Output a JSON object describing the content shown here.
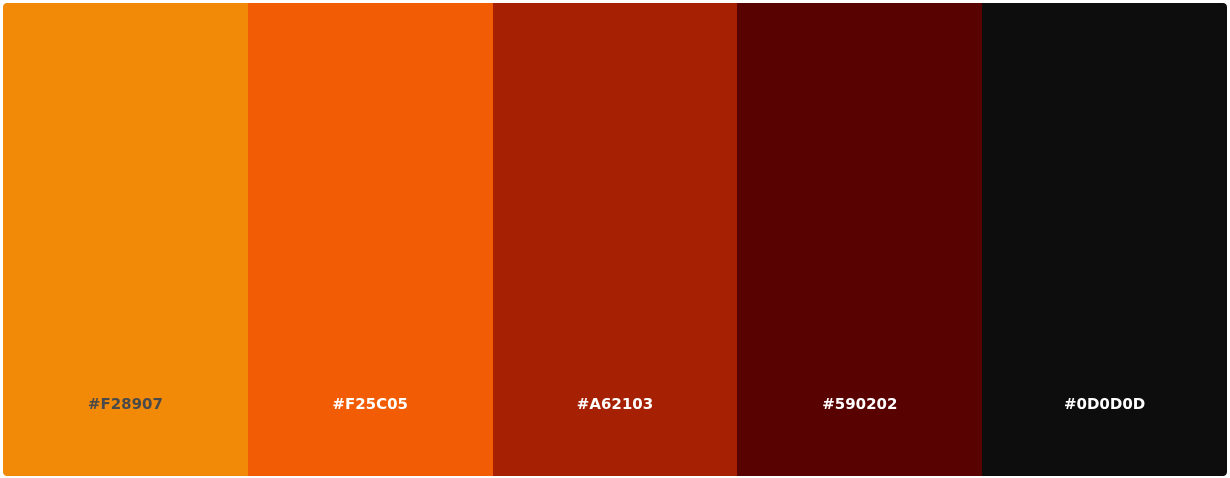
{
  "palette": {
    "swatches": [
      {
        "hex": "#F28907",
        "color": "#F28907",
        "label_color": "#4a4a4a"
      },
      {
        "hex": "#F25C05",
        "color": "#F25C05",
        "label_color": "#ffffff"
      },
      {
        "hex": "#A62103",
        "color": "#A62103",
        "label_color": "#ffffff"
      },
      {
        "hex": "#590202",
        "color": "#590202",
        "label_color": "#ffffff"
      },
      {
        "hex": "#0D0D0D",
        "color": "#0D0D0D",
        "label_color": "#ffffff"
      }
    ]
  }
}
